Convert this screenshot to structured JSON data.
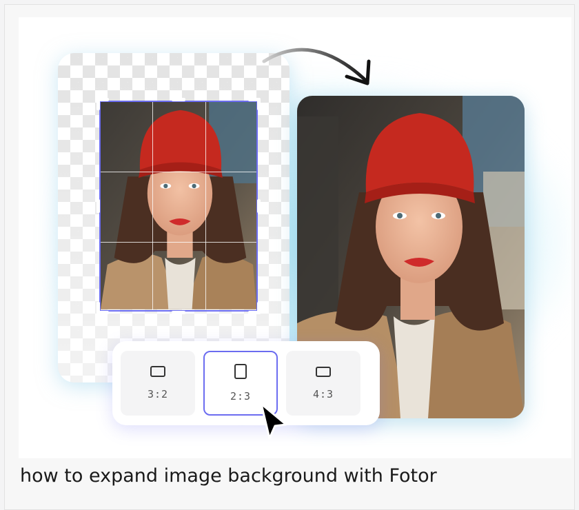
{
  "figure": {
    "ratio_options": [
      {
        "label": "3:2",
        "icon": "landscape-rect-icon",
        "selected": false
      },
      {
        "label": "2:3",
        "icon": "portrait-rect-icon",
        "selected": true
      },
      {
        "label": "4:3",
        "icon": "landscape-rect-icon",
        "selected": false
      }
    ],
    "accent_color": "#6b6cf0",
    "glow_color": "#b6e8f6"
  },
  "caption": "how to expand image background with Fotor"
}
